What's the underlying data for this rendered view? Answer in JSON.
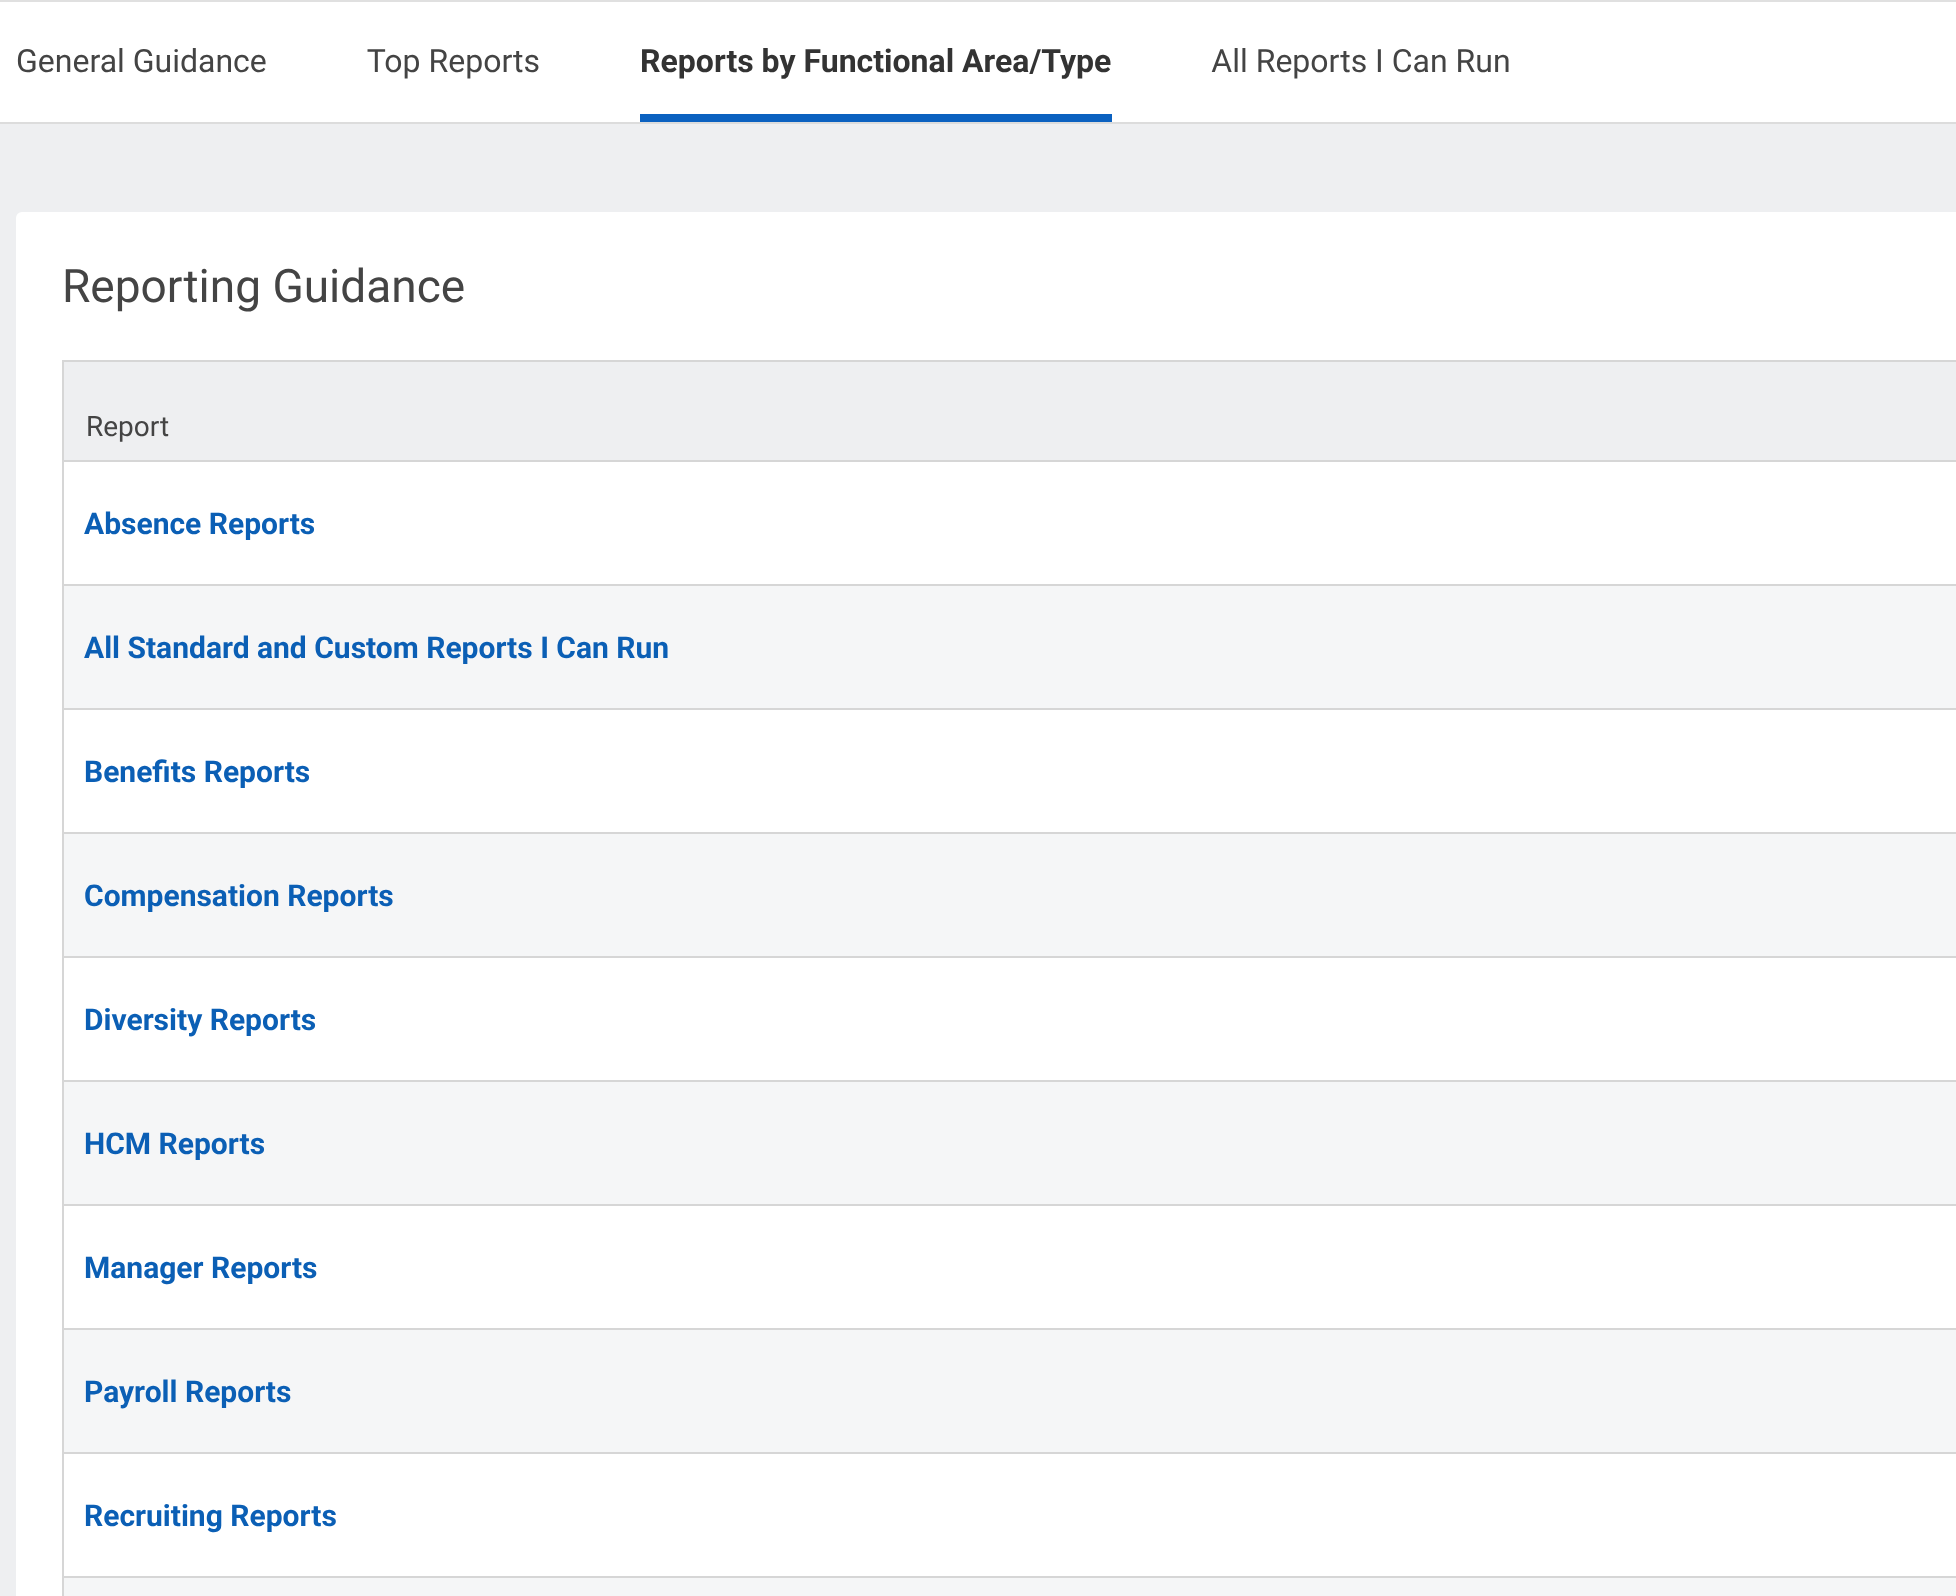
{
  "tabs": [
    {
      "label": "General Guidance",
      "selected": false
    },
    {
      "label": "Top Reports",
      "selected": false
    },
    {
      "label": "Reports by Functional Area/Type",
      "selected": true
    },
    {
      "label": "All Reports I Can Run",
      "selected": false
    }
  ],
  "card": {
    "title": "Reporting Guidance"
  },
  "table": {
    "columns": [
      "Report"
    ],
    "rows": [
      {
        "report": "Absence Reports"
      },
      {
        "report": "All Standard and Custom Reports I Can Run"
      },
      {
        "report": "Benefits Reports"
      },
      {
        "report": "Compensation Reports"
      },
      {
        "report": "Diversity Reports"
      },
      {
        "report": "HCM Reports"
      },
      {
        "report": "Manager Reports"
      },
      {
        "report": "Payroll Reports"
      },
      {
        "report": "Recruiting Reports"
      }
    ]
  }
}
